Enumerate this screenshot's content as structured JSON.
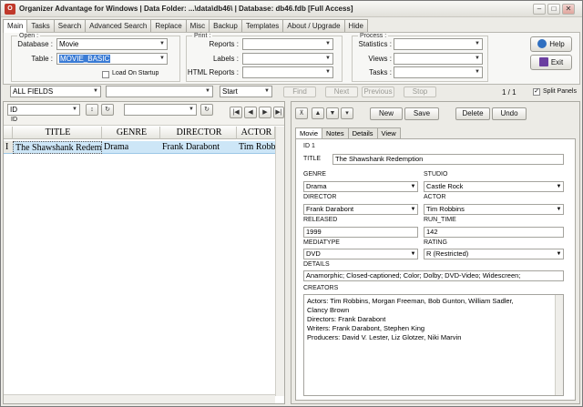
{
  "window": {
    "title": "Organizer Advantage for Windows | Data Folder: ...\\data\\db46\\ | Database: db46.fdb [Full Access]"
  },
  "tabs": [
    "Main",
    "Tasks",
    "Search",
    "Advanced Search",
    "Replace",
    "Misc",
    "Backup",
    "Templates",
    "About / Upgrade",
    "Hide"
  ],
  "ribbon": {
    "open": {
      "legend": "Open :",
      "database_label": "Database :",
      "database_value": "Movie",
      "table_label": "Table :",
      "table_value": "MOVIE_BASIC",
      "load_on_startup": "Load On Startup"
    },
    "print": {
      "legend": "Print :",
      "reports_label": "Reports :",
      "labels_label": "Labels :",
      "html_reports_label": "HTML Reports :"
    },
    "process": {
      "legend": "Process :",
      "statistics_label": "Statistics :",
      "views_label": "Views :",
      "tasks_label": "Tasks :"
    },
    "help_label": "Help",
    "exit_label": "Exit"
  },
  "searchbar": {
    "field_value": "ALL FIELDS",
    "mode_value": "Start",
    "find_label": "Find",
    "next_label": "Next",
    "previous_label": "Previous",
    "stop_label": "Stop",
    "record_counter": "1 / 1",
    "split_panels_label": "Split Panels"
  },
  "left": {
    "sort_field": "ID",
    "sort_sublabel": "ID",
    "columns": [
      "TITLE",
      "GENRE",
      "DIRECTOR",
      "ACTOR"
    ],
    "rows": [
      {
        "marker": "I",
        "title": "The Shawshank Redemption",
        "genre": "Drama",
        "director": "Frank Darabont",
        "actor": "Tim Robbins"
      }
    ]
  },
  "right": {
    "new_label": "New",
    "save_label": "Save",
    "delete_label": "Delete",
    "undo_label": "Undo",
    "tabs": [
      "Movie",
      "Notes",
      "Details",
      "View"
    ],
    "form": {
      "id_label": "ID 1",
      "title_label": "TITLE",
      "title_value": "The Shawshank Redemption",
      "genre_label": "GENRE",
      "genre_value": "Drama",
      "studio_label": "STUDIO",
      "studio_value": "Castle Rock",
      "director_label": "DIRECTOR",
      "director_value": "Frank Darabont",
      "actor_label": "ACTOR",
      "actor_value": "Tim Robbins",
      "released_label": "RELEASED",
      "released_value": "1999",
      "runtime_label": "RUN_TIME",
      "runtime_value": "142",
      "mediatype_label": "MEDIATYPE",
      "mediatype_value": "DVD",
      "rating_label": "RATING",
      "rating_value": "R (Restricted)",
      "details_label": "DETAILS",
      "details_value": "Anamorphic; Closed-captioned; Color; Dolby; DVD-Video; Widescreen;",
      "creators_label": "CREATORS",
      "creators_lines": [
        "Actors: Tim Robbins, Morgan Freeman, Bob Gunton, William Sadler,",
        "Clancy Brown",
        "Directors: Frank Darabont",
        "Writers: Frank Darabont, Stephen King",
        "Producers: David V. Lester, Liz Glotzer, Niki Marvin"
      ]
    }
  },
  "colors": {
    "selection": "#3a7bd5",
    "row_highlight": "#cde6f7",
    "help_icon": "#2f6fc0",
    "exit_icon": "#6b3fa0"
  }
}
